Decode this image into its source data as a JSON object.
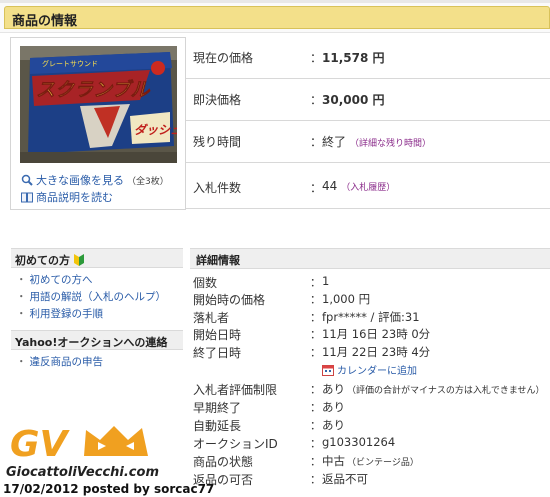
{
  "header": {
    "title": "商品の情報"
  },
  "image_panel": {
    "box_title_line1": "グレートサウンド",
    "box_title_line2": "スクランブル",
    "box_title_line3": "ダッシュ",
    "view_large_label": "大きな画像を見る",
    "view_large_note": "（全3枚）",
    "read_description_label": "商品説明を読む"
  },
  "price_info": {
    "rows": [
      {
        "label": "現在の価格",
        "value": "11,578 円",
        "sub": ""
      },
      {
        "label": "即決価格",
        "value": "30,000 円",
        "sub": ""
      },
      {
        "label": "残り時間",
        "value": "終了",
        "sub": "（詳細な残り時間）"
      },
      {
        "label": "入札件数",
        "value": "44",
        "sub": "（入札履歴）"
      }
    ],
    "colon": "："
  },
  "sidebar": {
    "beginner_title": "初めての方",
    "beginner_links": [
      "初めての方へ",
      "用語の解説（入札のヘルプ）",
      "利用登録の手順"
    ],
    "contact_title": "Yahoo!オークションへの連絡",
    "contact_links": [
      "違反商品の申告"
    ],
    "bullet": "・"
  },
  "details": {
    "title": "詳細情報",
    "rows": [
      {
        "label": "個数",
        "value": "1",
        "small": ""
      },
      {
        "label": "開始時の価格",
        "value": "1,000 円",
        "small": ""
      },
      {
        "label": "落札者",
        "value": "fpr***** / 評価:31",
        "small": ""
      },
      {
        "label": "開始日時",
        "value": "11月 16日 23時 0分",
        "small": ""
      },
      {
        "label": "終了日時",
        "value": "11月 22日 23時 4分",
        "small": ""
      },
      {
        "label": "入札者評価制限",
        "value": "あり",
        "small": "（評価の合計がマイナスの方は入札できません）"
      },
      {
        "label": "早期終了",
        "value": "あり",
        "small": ""
      },
      {
        "label": "自動延長",
        "value": "あり",
        "small": ""
      },
      {
        "label": "オークションID",
        "value": "g103301264",
        "small": ""
      },
      {
        "label": "商品の状態",
        "value": "中古",
        "small": "（ビンテージ品）"
      },
      {
        "label": "返品の可否",
        "value": "返品不可",
        "small": ""
      }
    ],
    "calendar_link": "カレンダーに追加"
  },
  "watermark": {
    "logo_text": "GV",
    "site": "GiocattoliVecchi.com",
    "caption": "17/02/2012 posted by sorcac77"
  },
  "colors": {
    "header_bg": "#f3e08a",
    "link": "#2a5ca8",
    "sub_link": "#8b2c8b",
    "logo_orange": "#f0a020"
  },
  "icons": [
    "magnifier-icon",
    "book-icon",
    "beginner-mark-icon",
    "calendar-icon",
    "crown-icon"
  ]
}
